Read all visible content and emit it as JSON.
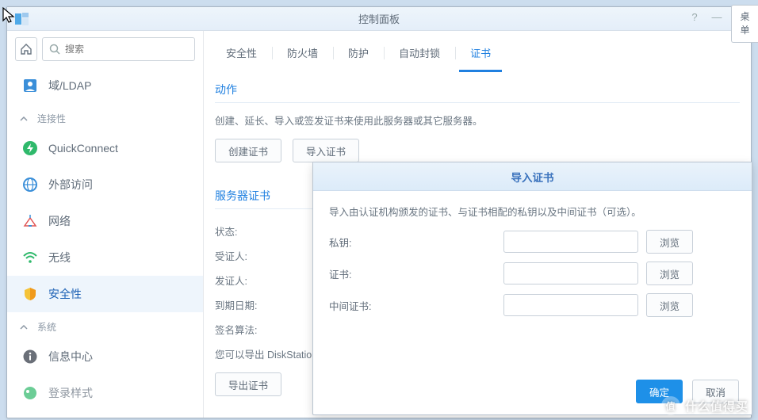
{
  "window": {
    "title": "控制面板"
  },
  "desktab": {
    "l1": "桌",
    "l2": "单"
  },
  "sidebar": {
    "search_placeholder": "搜索",
    "domain_label": "域/LDAP",
    "group1_label": "连接性",
    "quickconnect_label": "QuickConnect",
    "external_label": "外部访问",
    "network_label": "网络",
    "wireless_label": "无线",
    "security_label": "安全性",
    "group2_label": "系统",
    "info_label": "信息中心",
    "login_label": "登录样式"
  },
  "tabs": {
    "t0": "安全性",
    "t1": "防火墙",
    "t2": "防护",
    "t3": "自动封锁",
    "t4": "证书"
  },
  "actions": {
    "title": "动作",
    "desc": "创建、延长、导入或签发证书来使用此服务器或其它服务器。",
    "create_btn": "创建证书",
    "import_btn": "导入证书"
  },
  "servercert": {
    "title": "服务器证书",
    "status_label": "状态:",
    "subject_label": "受证人:",
    "issuer_label": "发证人:",
    "expire_label": "到期日期:",
    "algo_label": "签名算法:",
    "export_desc": "您可以导出 DiskStation",
    "export_btn": "导出证书"
  },
  "modal": {
    "title": "导入证书",
    "desc": "导入由认证机构颁发的证书、与证书相配的私钥以及中间证书（可选）。",
    "pkey_label": "私钥:",
    "cert_label": "证书:",
    "inter_label": "中间证书:",
    "browse_btn": "浏览",
    "ok_btn": "确定",
    "cancel_btn": "取消"
  },
  "watermark": {
    "char": "值",
    "text": "什么值得买"
  }
}
